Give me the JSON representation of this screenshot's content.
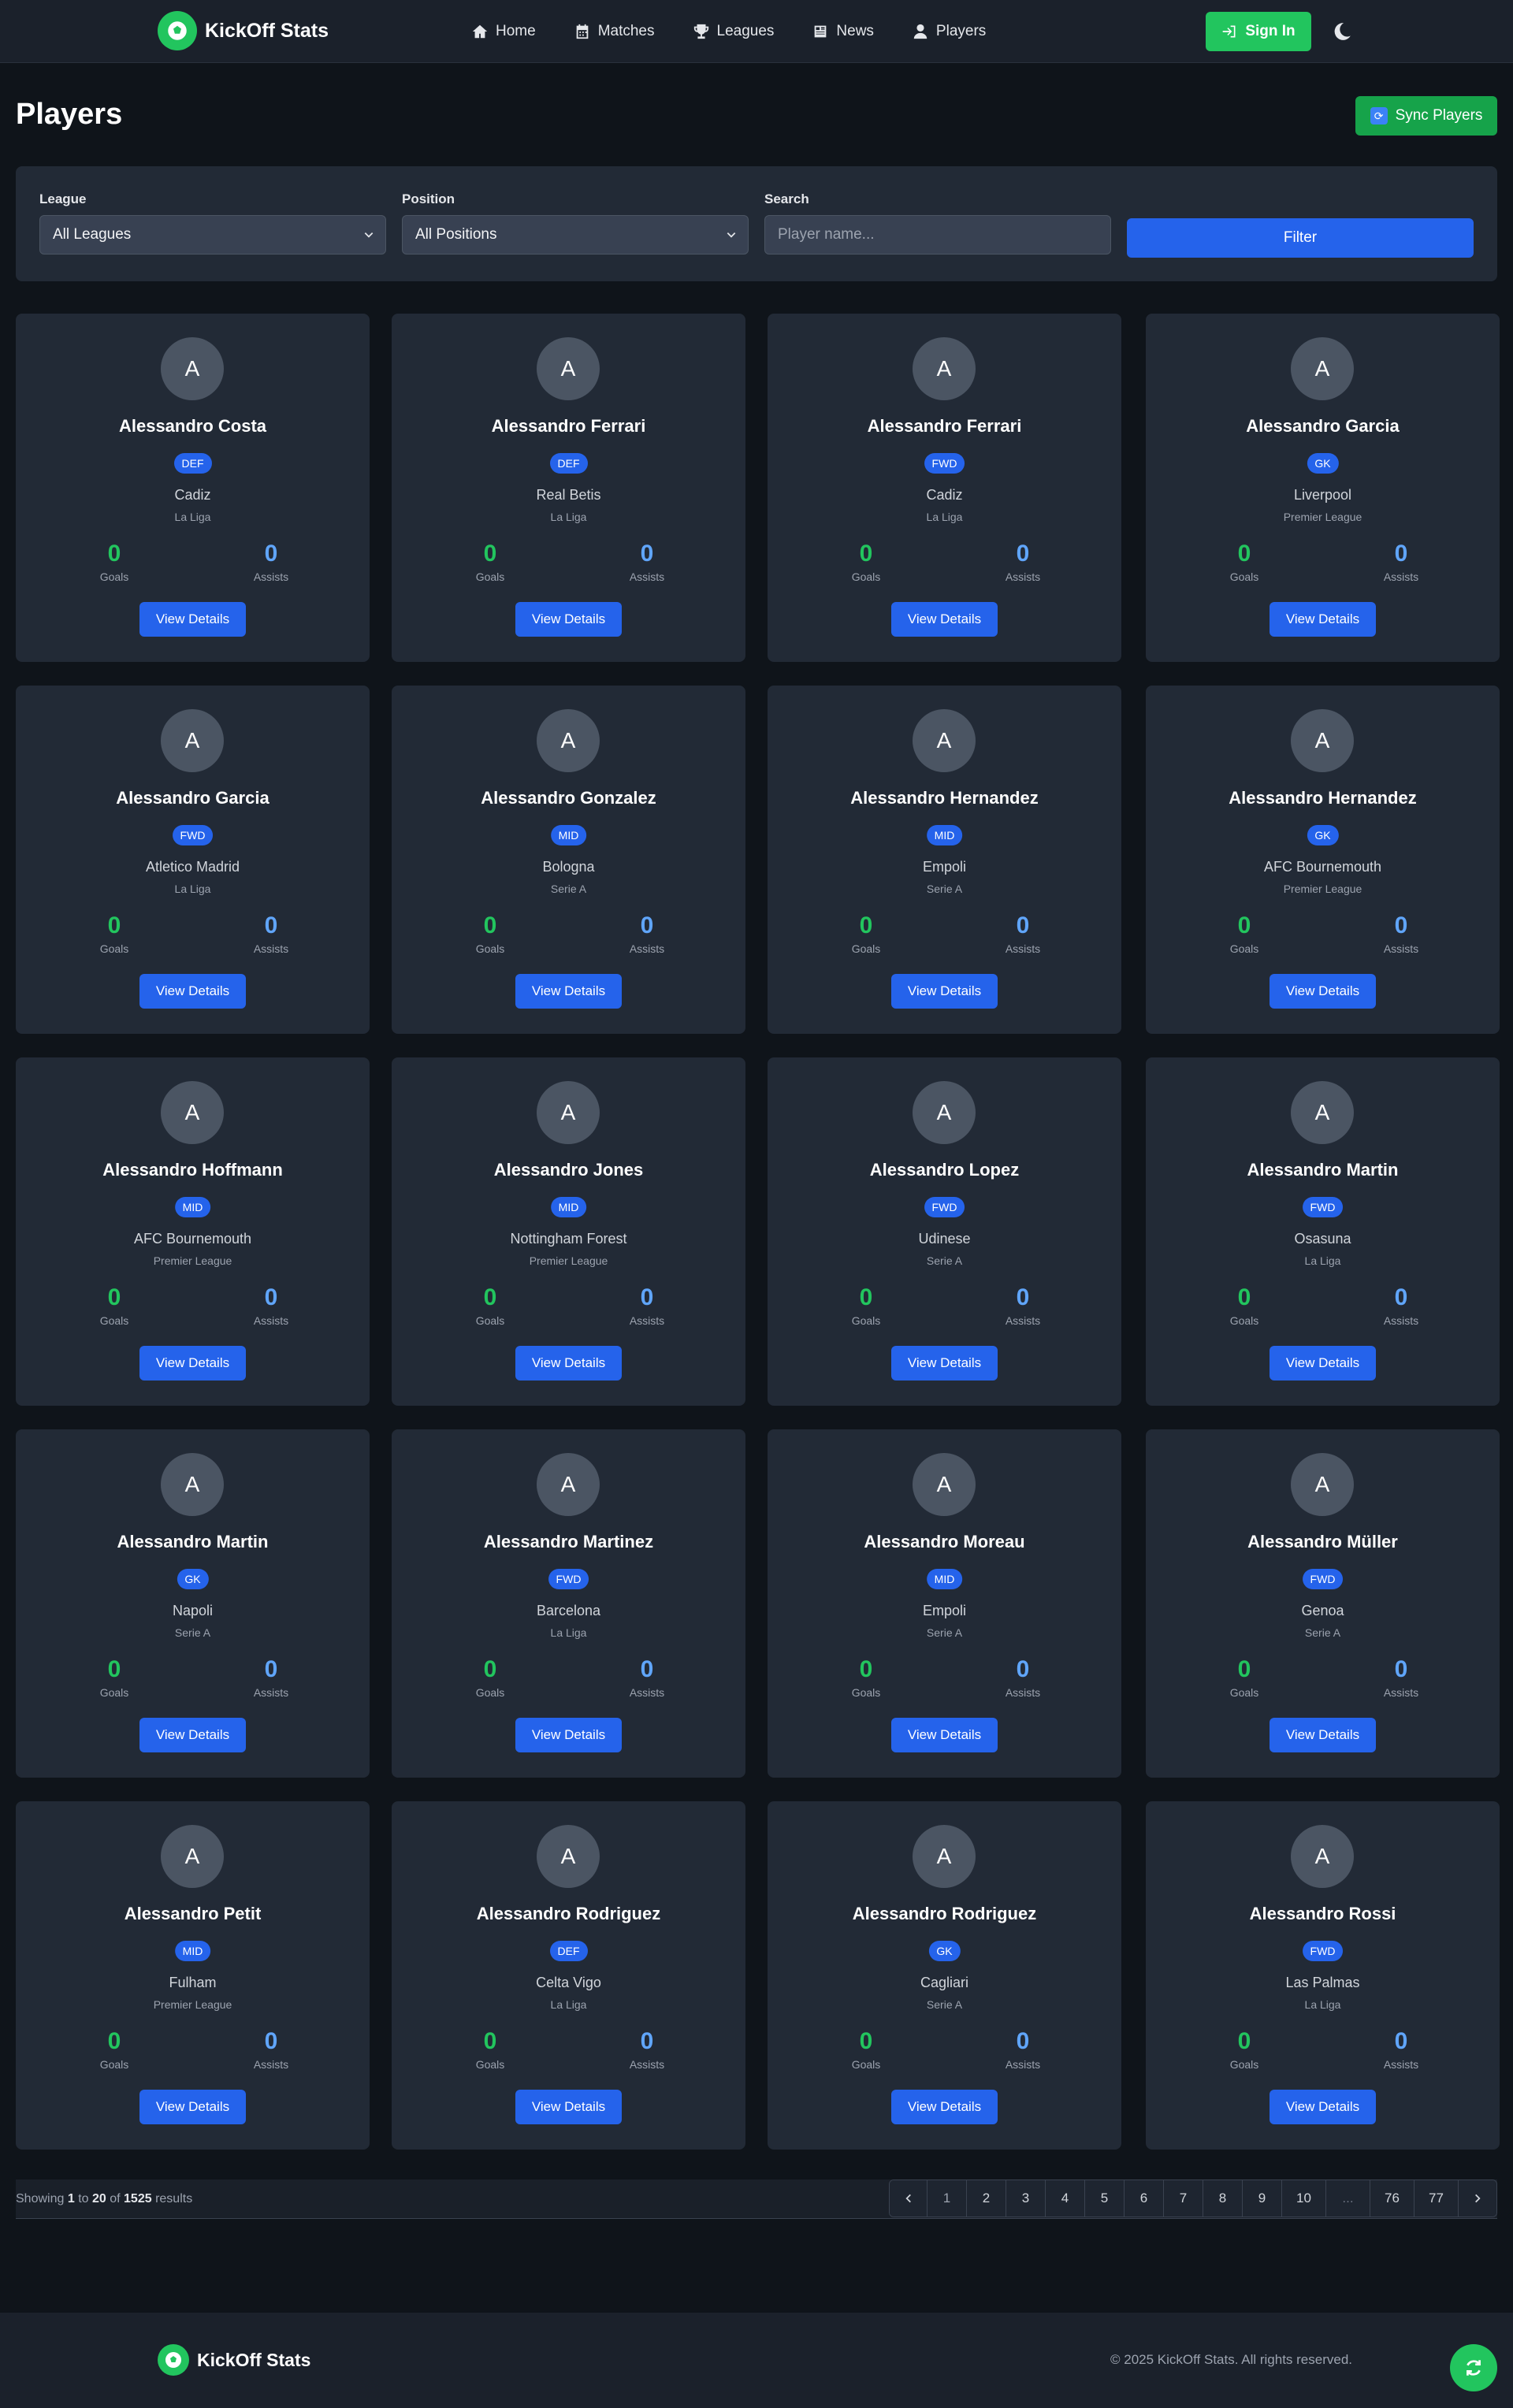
{
  "header": {
    "brand": "KickOff Stats",
    "nav": [
      {
        "label": "Home",
        "icon": "home-icon"
      },
      {
        "label": "Matches",
        "icon": "calendar-icon"
      },
      {
        "label": "Leagues",
        "icon": "trophy-icon"
      },
      {
        "label": "News",
        "icon": "newspaper-icon"
      },
      {
        "label": "Players",
        "icon": "user-icon"
      }
    ],
    "sign_in": "Sign In",
    "theme_icon": "moon-icon"
  },
  "page": {
    "title": "Players",
    "sync_label": "Sync Players"
  },
  "filters": {
    "league_label": "League",
    "league_value": "All Leagues",
    "position_label": "Position",
    "position_value": "All Positions",
    "search_label": "Search",
    "search_placeholder": "Player name...",
    "filter_button": "Filter"
  },
  "labels": {
    "goals": "Goals",
    "assists": "Assists",
    "view_details": "View Details"
  },
  "players": [
    {
      "initial": "A",
      "name": "Alessandro Costa",
      "position": "DEF",
      "team": "Cadiz",
      "league": "La Liga",
      "goals": "0",
      "assists": "0"
    },
    {
      "initial": "A",
      "name": "Alessandro Ferrari",
      "position": "DEF",
      "team": "Real Betis",
      "league": "La Liga",
      "goals": "0",
      "assists": "0"
    },
    {
      "initial": "A",
      "name": "Alessandro Ferrari",
      "position": "FWD",
      "team": "Cadiz",
      "league": "La Liga",
      "goals": "0",
      "assists": "0"
    },
    {
      "initial": "A",
      "name": "Alessandro Garcia",
      "position": "GK",
      "team": "Liverpool",
      "league": "Premier League",
      "goals": "0",
      "assists": "0"
    },
    {
      "initial": "A",
      "name": "Alessandro Garcia",
      "position": "FWD",
      "team": "Atletico Madrid",
      "league": "La Liga",
      "goals": "0",
      "assists": "0"
    },
    {
      "initial": "A",
      "name": "Alessandro Gonzalez",
      "position": "MID",
      "team": "Bologna",
      "league": "Serie A",
      "goals": "0",
      "assists": "0"
    },
    {
      "initial": "A",
      "name": "Alessandro Hernandez",
      "position": "MID",
      "team": "Empoli",
      "league": "Serie A",
      "goals": "0",
      "assists": "0"
    },
    {
      "initial": "A",
      "name": "Alessandro Hernandez",
      "position": "GK",
      "team": "AFC Bournemouth",
      "league": "Premier League",
      "goals": "0",
      "assists": "0"
    },
    {
      "initial": "A",
      "name": "Alessandro Hoffmann",
      "position": "MID",
      "team": "AFC Bournemouth",
      "league": "Premier League",
      "goals": "0",
      "assists": "0"
    },
    {
      "initial": "A",
      "name": "Alessandro Jones",
      "position": "MID",
      "team": "Nottingham Forest",
      "league": "Premier League",
      "goals": "0",
      "assists": "0"
    },
    {
      "initial": "A",
      "name": "Alessandro Lopez",
      "position": "FWD",
      "team": "Udinese",
      "league": "Serie A",
      "goals": "0",
      "assists": "0"
    },
    {
      "initial": "A",
      "name": "Alessandro Martin",
      "position": "FWD",
      "team": "Osasuna",
      "league": "La Liga",
      "goals": "0",
      "assists": "0"
    },
    {
      "initial": "A",
      "name": "Alessandro Martin",
      "position": "GK",
      "team": "Napoli",
      "league": "Serie A",
      "goals": "0",
      "assists": "0"
    },
    {
      "initial": "A",
      "name": "Alessandro Martinez",
      "position": "FWD",
      "team": "Barcelona",
      "league": "La Liga",
      "goals": "0",
      "assists": "0"
    },
    {
      "initial": "A",
      "name": "Alessandro Moreau",
      "position": "MID",
      "team": "Empoli",
      "league": "Serie A",
      "goals": "0",
      "assists": "0"
    },
    {
      "initial": "A",
      "name": "Alessandro Müller",
      "position": "FWD",
      "team": "Genoa",
      "league": "Serie A",
      "goals": "0",
      "assists": "0"
    },
    {
      "initial": "A",
      "name": "Alessandro Petit",
      "position": "MID",
      "team": "Fulham",
      "league": "Premier League",
      "goals": "0",
      "assists": "0"
    },
    {
      "initial": "A",
      "name": "Alessandro Rodriguez",
      "position": "DEF",
      "team": "Celta Vigo",
      "league": "La Liga",
      "goals": "0",
      "assists": "0"
    },
    {
      "initial": "A",
      "name": "Alessandro Rodriguez",
      "position": "GK",
      "team": "Cagliari",
      "league": "Serie A",
      "goals": "0",
      "assists": "0"
    },
    {
      "initial": "A",
      "name": "Alessandro Rossi",
      "position": "FWD",
      "team": "Las Palmas",
      "league": "La Liga",
      "goals": "0",
      "assists": "0"
    }
  ],
  "pagination": {
    "showing_prefix": "Showing",
    "from": "1",
    "to_word": "to",
    "to": "20",
    "of_word": "of",
    "total": "1525",
    "results_word": "results",
    "pages": [
      "1",
      "2",
      "3",
      "4",
      "5",
      "6",
      "7",
      "8",
      "9",
      "10",
      "...",
      "76",
      "77"
    ],
    "current": "1"
  },
  "footer": {
    "brand": "KickOff Stats",
    "copyright": "© 2025 KickOff Stats. All rights reserved."
  },
  "colors": {
    "background": "#0f141a",
    "panel": "#222a36",
    "accent_green": "#22c55e",
    "accent_blue": "#2563eb",
    "assists_blue": "#60a5fa"
  }
}
